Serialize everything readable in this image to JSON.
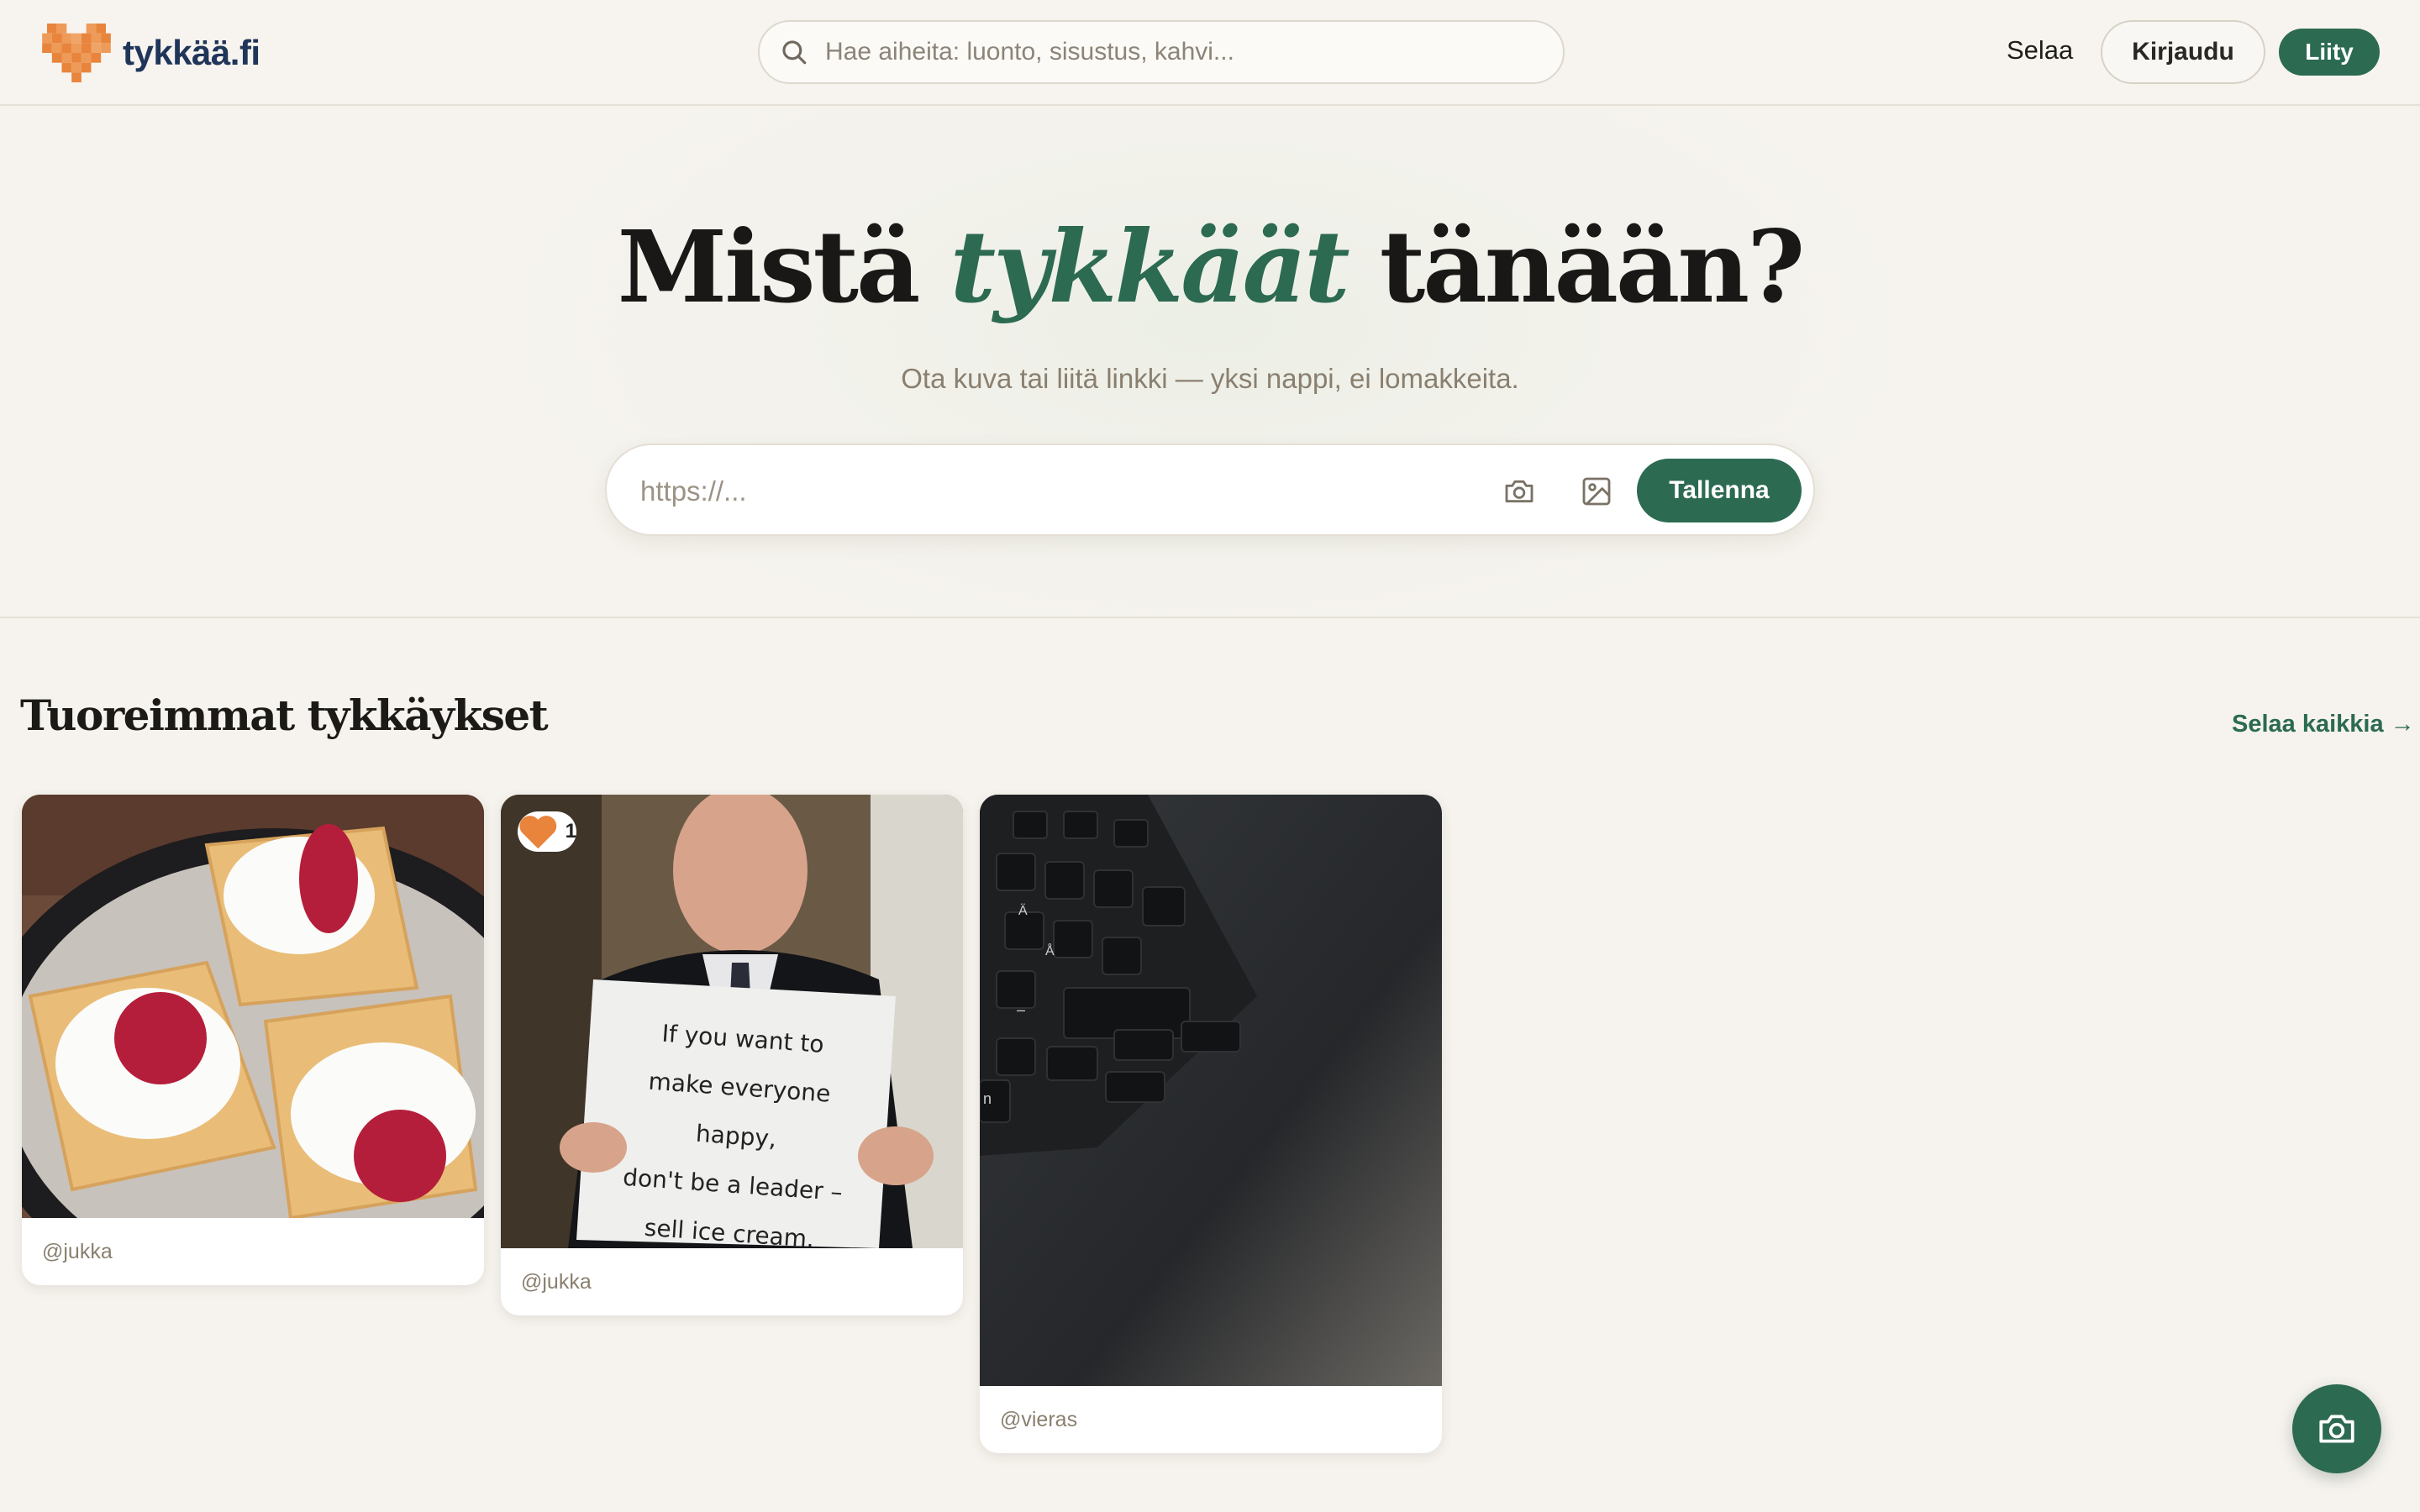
{
  "header": {
    "logo_text": "tykkää.fi",
    "search_placeholder": "Hae aiheita: luonto, sisustus, kahvi...",
    "browse_label": "Selaa",
    "login_label": "Kirjaudu",
    "join_label": "Liity"
  },
  "hero": {
    "title_before": "Mistä",
    "title_accent": "tykkäät",
    "title_after": "tänään?",
    "subtitle": "Ota kuva tai liitä linkki — yksi nappi, ei lomakkeita.",
    "url_placeholder": "https://...",
    "save_label": "Tallenna"
  },
  "feed": {
    "title": "Tuoreimmat tykkäykset",
    "see_all_label": "Selaa kaikkia →",
    "posts": [
      {
        "author": "@jukka",
        "likes": "",
        "image": "waffles with cream and jam"
      },
      {
        "author": "@jukka",
        "likes": "1",
        "image": "man holding sign",
        "sign_lines": [
          "If you want to",
          "make everyone",
          "happy,",
          "don't be a leader –",
          "sell ice cream."
        ]
      },
      {
        "author": "@vieras",
        "image": "laptop keyboard",
        "key_labels": [
          "Ä",
          "Å",
          "–",
          "n"
        ]
      }
    ]
  },
  "colors": {
    "accent": "#2c6a52",
    "brand_orange": "#e8843c",
    "brand_navy": "#1f3559"
  },
  "icons": [
    "heart-logo-icon",
    "search-icon",
    "camera-icon",
    "image-icon",
    "heart-icon",
    "camera-fab-icon"
  ]
}
